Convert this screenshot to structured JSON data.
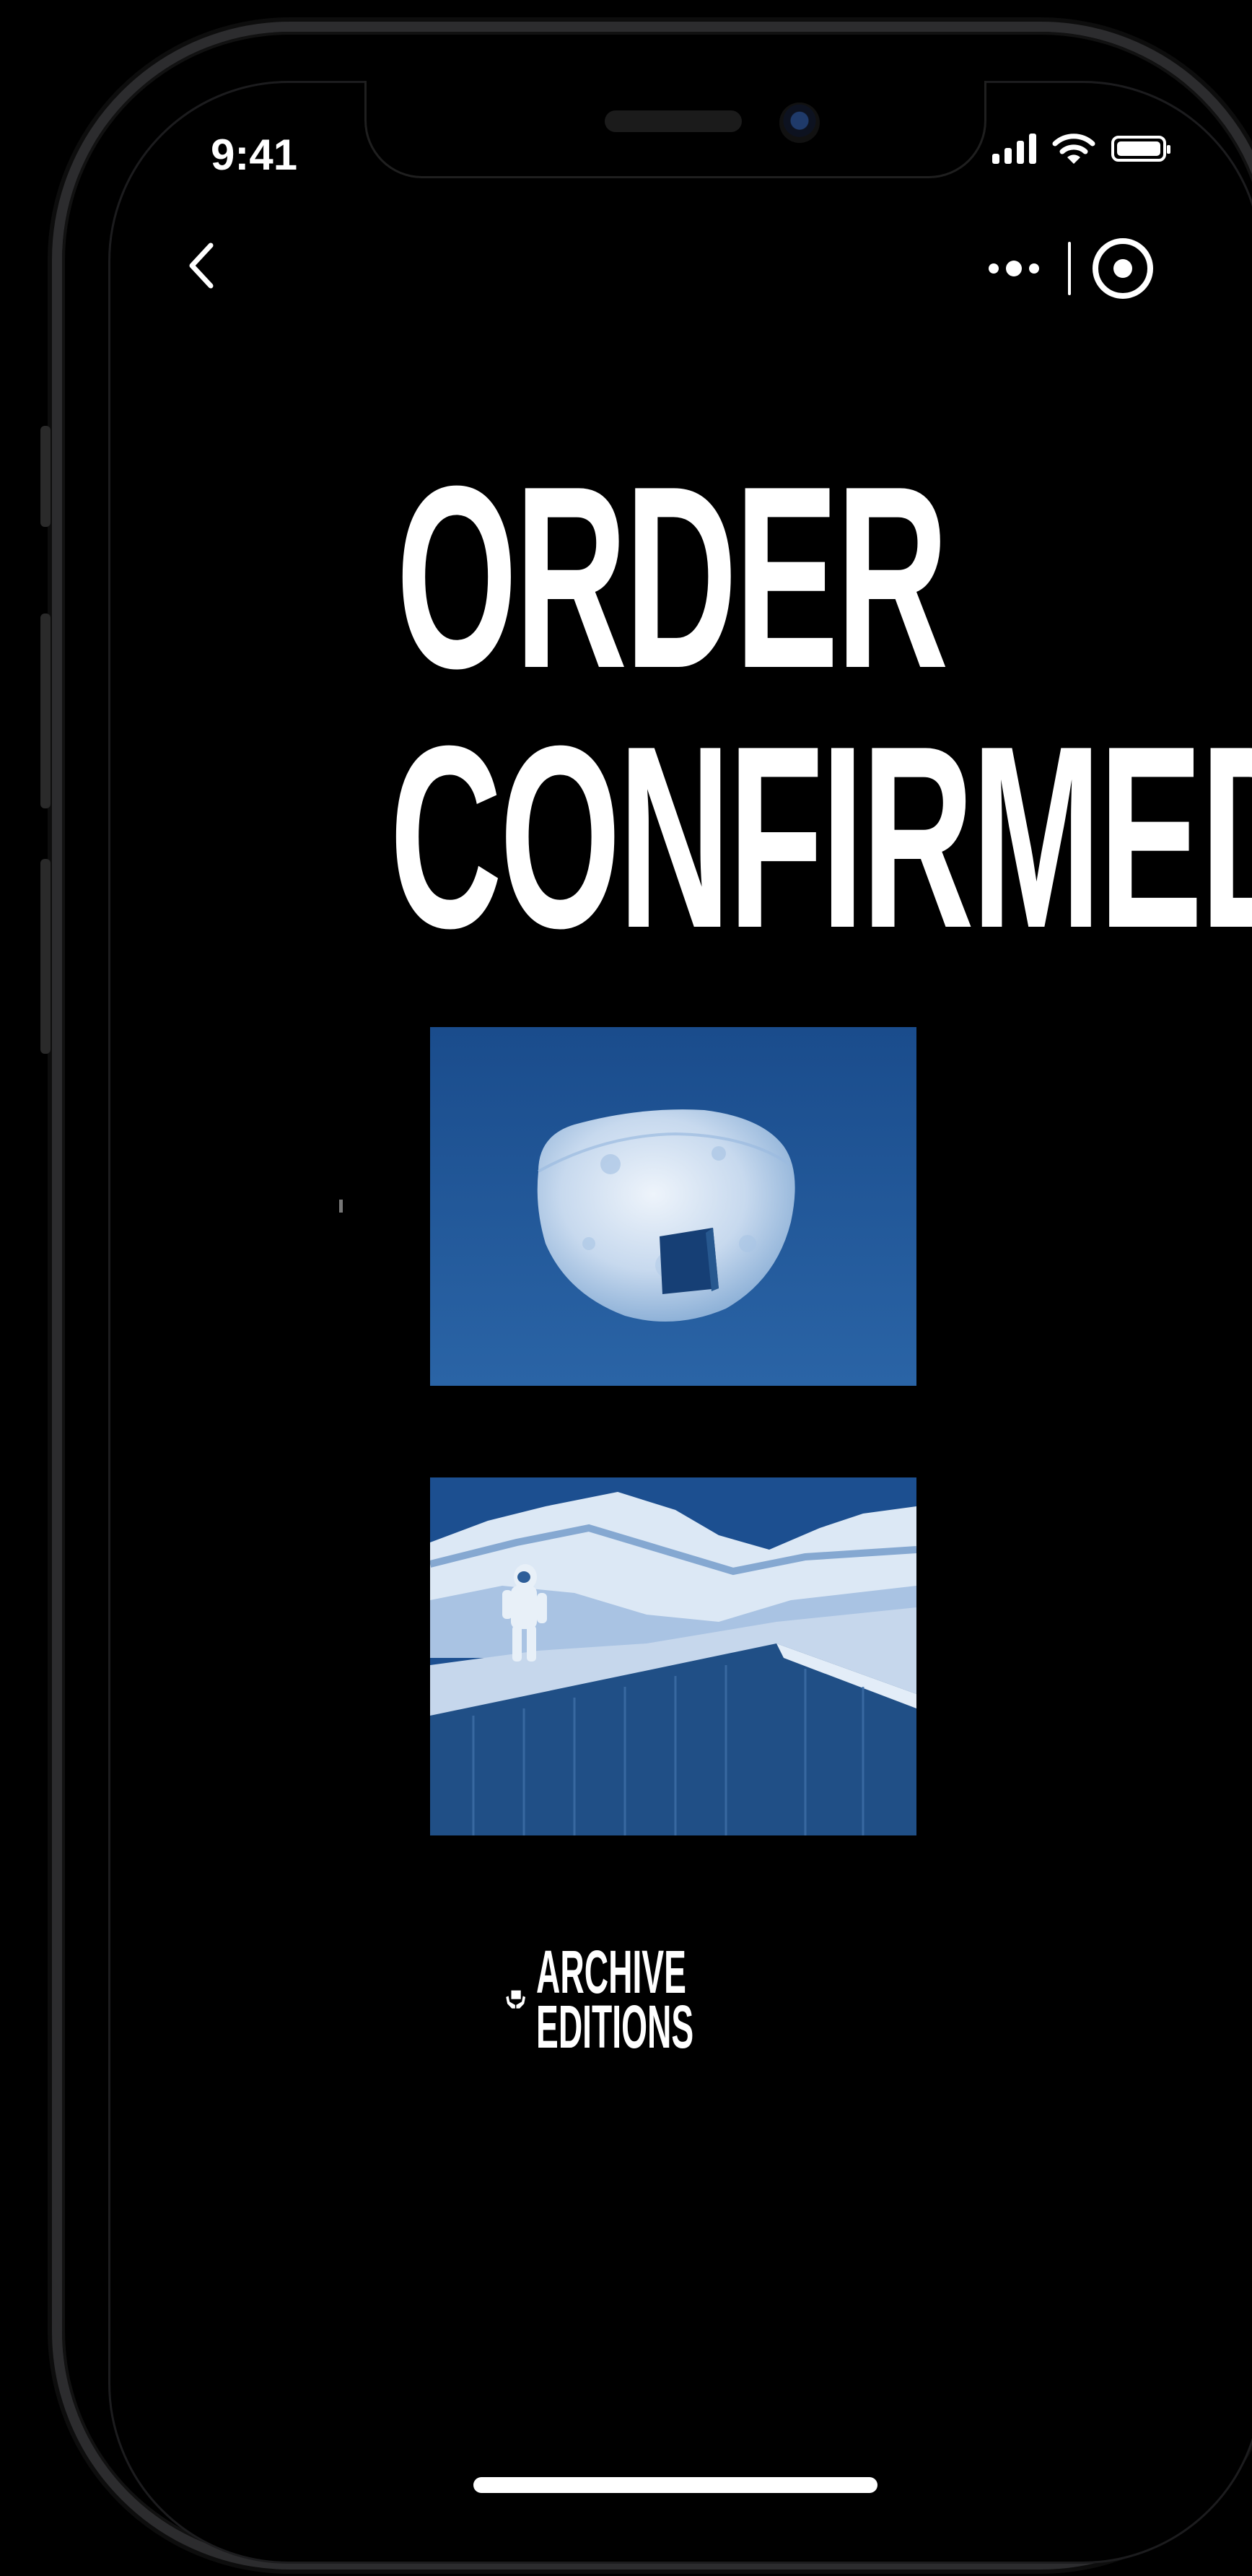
{
  "status_bar": {
    "time": "9:41"
  },
  "nav": {
    "back_icon": "chevron-left-icon",
    "more_icon": "more-dots-icon",
    "close_icon": "target-circle-icon"
  },
  "headline": {
    "line1": "ORDER",
    "line2": "CONFIRMED"
  },
  "artworks": [
    {
      "name": "moon-with-doorway-cyanotype"
    },
    {
      "name": "astronaut-on-cliff-cyanotype"
    }
  ],
  "logo": {
    "line1": "ARCHIVE",
    "line2": "EDITIONS",
    "icon": "box-in-hands-icon"
  },
  "colors": {
    "background": "#000000",
    "text": "#FFFFFF",
    "cyanotype_blue": "#1C4F90"
  }
}
